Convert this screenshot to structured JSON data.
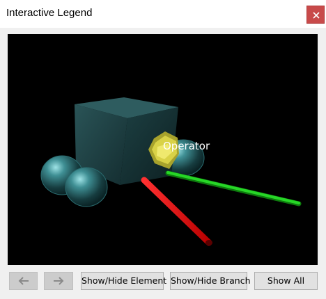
{
  "window": {
    "title": "Interactive Legend",
    "close_icon": "close-x-icon"
  },
  "viewport": {
    "background": "#000000",
    "label": "Operator",
    "objects": [
      "cube",
      "sphere",
      "sphere",
      "sphere",
      "operator-polyhedron",
      "red-axis-rod",
      "green-axis-rod"
    ],
    "colors": {
      "cube": "#1f3f42",
      "sphere": "#3e8e93",
      "operator": "#c9c43a",
      "red_rod": "#e00000",
      "green_rod": "#19c519"
    }
  },
  "toolbar": {
    "back_icon": "arrow-left-icon",
    "forward_icon": "arrow-right-icon",
    "show_hide_element": "Show/Hide Element",
    "show_hide_branch": "Show/Hide Branch",
    "show_all": "Show All"
  }
}
